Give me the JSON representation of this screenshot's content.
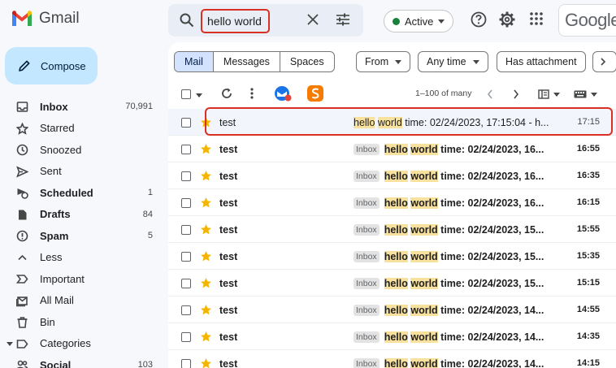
{
  "app": {
    "name": "Gmail"
  },
  "search": {
    "query": "hello world"
  },
  "status": {
    "label": "Active",
    "color": "#188038"
  },
  "header": {
    "brand_text": "Google"
  },
  "sidebar": {
    "compose_label": "Compose",
    "items": [
      {
        "label": "Inbox",
        "count": "70,991",
        "bold": true,
        "icon": "inbox-icon"
      },
      {
        "label": "Starred",
        "count": "",
        "bold": false,
        "icon": "star-outline-icon"
      },
      {
        "label": "Snoozed",
        "count": "",
        "bold": false,
        "icon": "clock-icon"
      },
      {
        "label": "Sent",
        "count": "",
        "bold": false,
        "icon": "send-icon"
      },
      {
        "label": "Scheduled",
        "count": "1",
        "bold": true,
        "icon": "schedule-send-icon"
      },
      {
        "label": "Drafts",
        "count": "84",
        "bold": true,
        "icon": "draft-icon"
      },
      {
        "label": "Spam",
        "count": "5",
        "bold": true,
        "icon": "spam-icon"
      },
      {
        "label": "Less",
        "count": "",
        "bold": false,
        "icon": "chevron-up-icon"
      },
      {
        "label": "Important",
        "count": "",
        "bold": false,
        "icon": "label-important-icon"
      },
      {
        "label": "All Mail",
        "count": "",
        "bold": false,
        "icon": "all-mail-icon"
      },
      {
        "label": "Bin",
        "count": "",
        "bold": false,
        "icon": "trash-icon"
      },
      {
        "label": "Categories",
        "count": "",
        "bold": false,
        "icon": "label-icon"
      },
      {
        "label": "Social",
        "count": "103",
        "bold": true,
        "icon": "people-icon"
      }
    ]
  },
  "filters": {
    "segments": [
      "Mail",
      "Messages",
      "Spaces"
    ],
    "selected_segment": "Mail",
    "from_label": "From",
    "any_time_label": "Any time",
    "has_attachment_label": "Has attachment"
  },
  "toolbar": {
    "pagination": "1–100 of many"
  },
  "emails": [
    {
      "sender": "test",
      "tag": "",
      "hl1": "hello",
      "hl2": "world",
      "subject": "time: 02/24/2023, 17:15:04 - h...",
      "time": "17:15",
      "read": true
    },
    {
      "sender": "test",
      "tag": "Inbox",
      "hl1": "hello",
      "hl2": "world",
      "subject": "time: 02/24/2023, 16...",
      "time": "16:55",
      "read": false
    },
    {
      "sender": "test",
      "tag": "Inbox",
      "hl1": "hello",
      "hl2": "world",
      "subject": "time: 02/24/2023, 16...",
      "time": "16:35",
      "read": false
    },
    {
      "sender": "test",
      "tag": "Inbox",
      "hl1": "hello",
      "hl2": "world",
      "subject": "time: 02/24/2023, 16...",
      "time": "16:15",
      "read": false
    },
    {
      "sender": "test",
      "tag": "Inbox",
      "hl1": "hello",
      "hl2": "world",
      "subject": "time: 02/24/2023, 15...",
      "time": "15:55",
      "read": false
    },
    {
      "sender": "test",
      "tag": "Inbox",
      "hl1": "hello",
      "hl2": "world",
      "subject": "time: 02/24/2023, 15...",
      "time": "15:35",
      "read": false
    },
    {
      "sender": "test",
      "tag": "Inbox",
      "hl1": "hello",
      "hl2": "world",
      "subject": "time: 02/24/2023, 15...",
      "time": "15:15",
      "read": false
    },
    {
      "sender": "test",
      "tag": "Inbox",
      "hl1": "hello",
      "hl2": "world",
      "subject": "time: 02/24/2023, 14...",
      "time": "14:55",
      "read": false
    },
    {
      "sender": "test",
      "tag": "Inbox",
      "hl1": "hello",
      "hl2": "world",
      "subject": "time: 02/24/2023, 14...",
      "time": "14:35",
      "read": false
    },
    {
      "sender": "test",
      "tag": "Inbox",
      "hl1": "hello",
      "hl2": "world",
      "subject": "time: 02/24/2023, 14...",
      "time": "14:15",
      "read": false
    }
  ]
}
